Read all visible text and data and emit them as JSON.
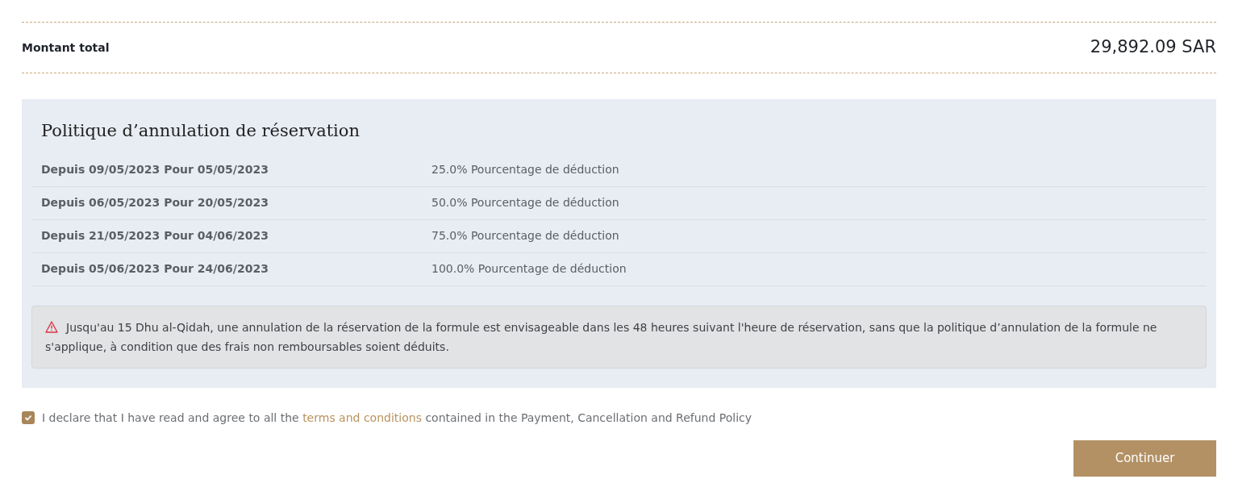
{
  "total": {
    "label": "Montant total",
    "amount": "29,892.09 SAR"
  },
  "policy": {
    "title": "Politique d’annulation de réservation",
    "rows": [
      {
        "period": "Depuis 09/05/2023 Pour 05/05/2023",
        "deduction": "25.0% Pourcentage de déduction"
      },
      {
        "period": "Depuis 06/05/2023 Pour 20/05/2023",
        "deduction": "50.0% Pourcentage de déduction"
      },
      {
        "period": "Depuis 21/05/2023 Pour 04/06/2023",
        "deduction": "75.0% Pourcentage de déduction"
      },
      {
        "period": "Depuis 05/06/2023 Pour 24/06/2023",
        "deduction": "100.0% Pourcentage de déduction"
      }
    ],
    "notice": "Jusqu'au 15 Dhu al-Qidah, une annulation de la réservation de la formule est envisageable dans les 48 heures suivant l'heure de réservation, sans que la politique d’annulation de la formule ne s'applique, à condition que des frais non remboursables soient déduits."
  },
  "agreement": {
    "checked": true,
    "before": "I declare that I have read and agree to all the",
    "link": "terms and conditions",
    "after": "contained in the Payment, Cancellation and Refund Policy"
  },
  "button": "Continuer"
}
